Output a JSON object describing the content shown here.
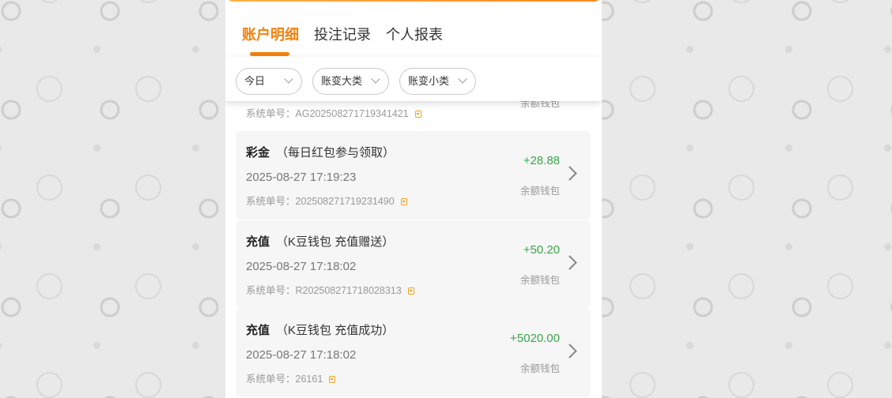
{
  "tabs": [
    {
      "label": "账户明细"
    },
    {
      "label": "投注记录"
    },
    {
      "label": "个人报表"
    }
  ],
  "filters": [
    {
      "label": "今日"
    },
    {
      "label": "账变大类"
    },
    {
      "label": "账变小类"
    }
  ],
  "partial_row": {
    "order_label": "系统单号：",
    "order_no": "AG202508271719341421",
    "wallet": "余额钱包"
  },
  "records": [
    {
      "type": "彩金",
      "detail": "（每日红包参与领取）",
      "date": "2025-08-27 17:19:23",
      "order_label": "系统单号：",
      "order_no": "202508271719231490",
      "amount": "+28.88",
      "wallet": "余额钱包"
    },
    {
      "type": "充值",
      "detail": "（K豆钱包 充值赠送）",
      "date": "2025-08-27 17:18:02",
      "order_label": "系统单号：",
      "order_no": "R202508271718028313",
      "amount": "+50.20",
      "wallet": "余额钱包"
    },
    {
      "type": "充值",
      "detail": "（K豆钱包 充值成功）",
      "date": "2025-08-27 17:18:02",
      "order_label": "系统单号：",
      "order_no": "26161",
      "amount": "+5020.00",
      "wallet": "余额钱包"
    }
  ],
  "colors": {
    "accent": "#f4810c",
    "positive_amount": "#3aa54b"
  }
}
